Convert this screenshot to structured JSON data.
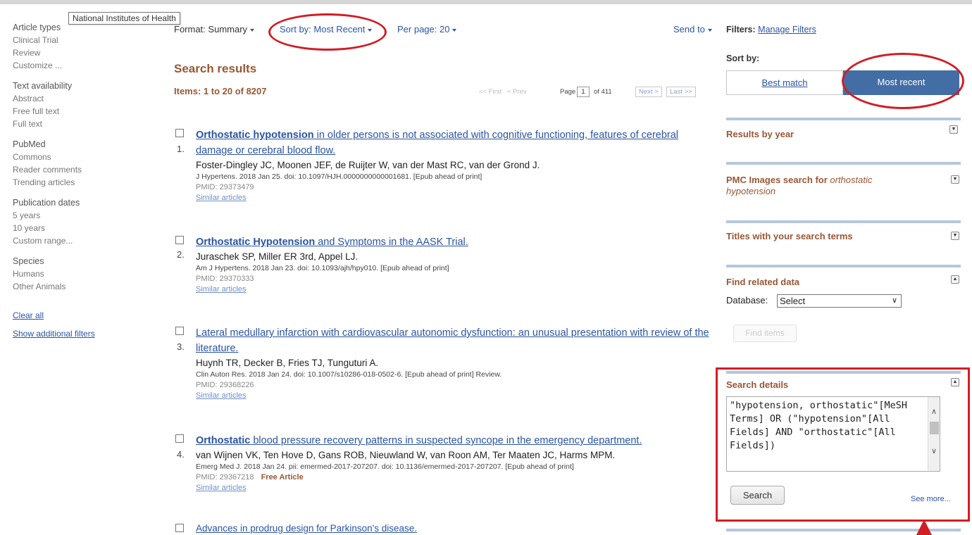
{
  "tooltip": "National Institutes of Health",
  "left_filters": {
    "groups": [
      {
        "heading": "Article types",
        "items": [
          "Clinical Trial",
          "Review",
          "Customize ..."
        ]
      },
      {
        "heading": "Text availability",
        "items": [
          "Abstract",
          "Free full text",
          "Full text"
        ]
      },
      {
        "heading": "PubMed",
        "items": [
          "Commons",
          "Reader comments",
          "Trending articles"
        ]
      },
      {
        "heading": "Publication dates",
        "items": [
          "5 years",
          "10 years",
          "Custom range..."
        ]
      },
      {
        "heading": "Species",
        "items": [
          "Humans",
          "Other Animals"
        ]
      }
    ],
    "clear_all": "Clear all",
    "show_additional": "Show additional filters"
  },
  "toolbar": {
    "format_label": "Format:",
    "format_value": "Summary",
    "sort_label": "Sort by:",
    "sort_value": "Most Recent",
    "perpage_label": "Per page:",
    "perpage_value": "20",
    "send_to": "Send to"
  },
  "results_header": {
    "title": "Search results",
    "items": "Items: 1 to 20 of 8207"
  },
  "pager": {
    "first": "<< First",
    "prev": "< Prev",
    "page_label": "Page",
    "page_value": "1",
    "of": "of 411",
    "next": "Next >",
    "last": "Last >>"
  },
  "results": [
    {
      "num": "1.",
      "title_bold": "Orthostatic hypotension",
      "title_rest": " in older persons is not associated with cognitive functioning, features of cerebral damage or cerebral blood flow.",
      "authors": "Foster-Dingley JC, Moonen JEF, de Ruijter W, van der Mast RC, van der Grond J.",
      "citation": "J Hypertens. 2018 Jan 25. doi: 10.1097/HJH.0000000000001681. [Epub ahead of print]",
      "pmid": "PMID: 29373479",
      "free": "",
      "similar": "Similar articles"
    },
    {
      "num": "2.",
      "title_bold": "Orthostatic Hypotension",
      "title_rest": " and Symptoms in the AASK Trial.",
      "authors": "Juraschek SP, Miller ER 3rd, Appel LJ.",
      "citation": "Am J Hypertens. 2018 Jan 23. doi: 10.1093/ajh/hpy010. [Epub ahead of print]",
      "pmid": "PMID: 29370333",
      "free": "",
      "similar": "Similar articles"
    },
    {
      "num": "3.",
      "title_bold": "",
      "title_rest": "Lateral medullary infarction with cardiovascular autonomic dysfunction: an unusual presentation with review of the literature.",
      "authors": "Huynh TR, Decker B, Fries TJ, Tunguturi A.",
      "citation": "Clin Auton Res. 2018 Jan 24. doi: 10.1007/s10286-018-0502-6. [Epub ahead of print] Review.",
      "pmid": "PMID: 29368226",
      "free": "",
      "similar": "Similar articles"
    },
    {
      "num": "4.",
      "title_bold": "Orthostatic",
      "title_rest": " blood pressure recovery patterns in suspected syncope in the emergency department.",
      "authors": "van Wijnen VK, Ten Hove D, Gans ROB, Nieuwland W, van Roon AM, Ter Maaten JC, Harms MPM.",
      "citation": "Emerg Med J. 2018 Jan 24. pii: emermed-2017-207207. doi: 10.1136/emermed-2017-207207. [Epub ahead of print]",
      "pmid": "PMID: 29367218",
      "free": "Free Article",
      "similar": "Similar articles"
    },
    {
      "num": "",
      "title_bold": "",
      "title_rest": "Advances in prodrug design for Parkinson's disease.",
      "authors": "",
      "citation": "",
      "pmid": "",
      "free": "",
      "similar": ""
    }
  ],
  "right": {
    "filters_label": "Filters:",
    "manage_filters": "Manage Filters",
    "sort_by": "Sort by:",
    "best_match": "Best match",
    "most_recent": "Most recent",
    "results_by_year": "Results by year",
    "pmc_title": "PMC Images search for ",
    "pmc_query": "orthostatic hypotension",
    "titles_with_terms": "Titles with your search terms",
    "find_related": "Find related data",
    "database_label": "Database:",
    "database_value": "Select",
    "find_items": "Find items",
    "search_details": "Search details",
    "query_text": "\"hypotension, orthostatic\"[MeSH Terms] OR (\"hypotension\"[All Fields] AND \"orthostatic\"[All Fields])",
    "search_button": "Search",
    "see_more": "See more..."
  },
  "colors": {
    "link": "#2a54a4",
    "heading_brown": "#985735",
    "sort_active_bg": "#426ea5",
    "annotation_red": "#d01e25",
    "panel_bar": "#b6c7dc"
  }
}
